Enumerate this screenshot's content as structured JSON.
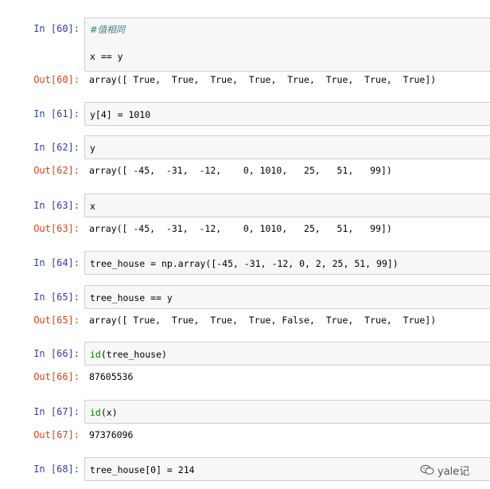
{
  "cells": [
    {
      "in_prompt": "In [60]:",
      "lines": [
        "#值相同",
        "",
        "x == y"
      ],
      "out_prompt": "Out[60]:",
      "output": "array([ True,  True,  True,  True,  True,  True,  True,  True])"
    },
    {
      "in_prompt": "In [61]:",
      "code": "y[4] = 1010"
    },
    {
      "in_prompt": "In [62]:",
      "code": "y",
      "out_prompt": "Out[62]:",
      "output": "array([ -45,  -31,  -12,    0, 1010,   25,   51,   99])"
    },
    {
      "in_prompt": "In [63]:",
      "code": "x",
      "out_prompt": "Out[63]:",
      "output": "array([ -45,  -31,  -12,    0, 1010,   25,   51,   99])"
    },
    {
      "in_prompt": "In [64]:",
      "code": "tree_house = np.array([-45, -31, -12, 0, 2, 25, 51, 99])"
    },
    {
      "in_prompt": "In [65]:",
      "code": "tree_house == y",
      "out_prompt": "Out[65]:",
      "output": "array([ True,  True,  True,  True, False,  True,  True,  True])"
    },
    {
      "in_prompt": "In [66]:",
      "code_builtin": "id",
      "code_rest": "(tree_house)",
      "out_prompt": "Out[66]:",
      "output": "87605536"
    },
    {
      "in_prompt": "In [67]:",
      "code_builtin": "id",
      "code_rest": "(x)",
      "out_prompt": "Out[67]:",
      "output": "97376096"
    },
    {
      "in_prompt": "In [68]:",
      "code": "tree_house[0] = 214"
    }
  ],
  "watermark": {
    "text": "yale记",
    "icon": "wechat-icon"
  }
}
